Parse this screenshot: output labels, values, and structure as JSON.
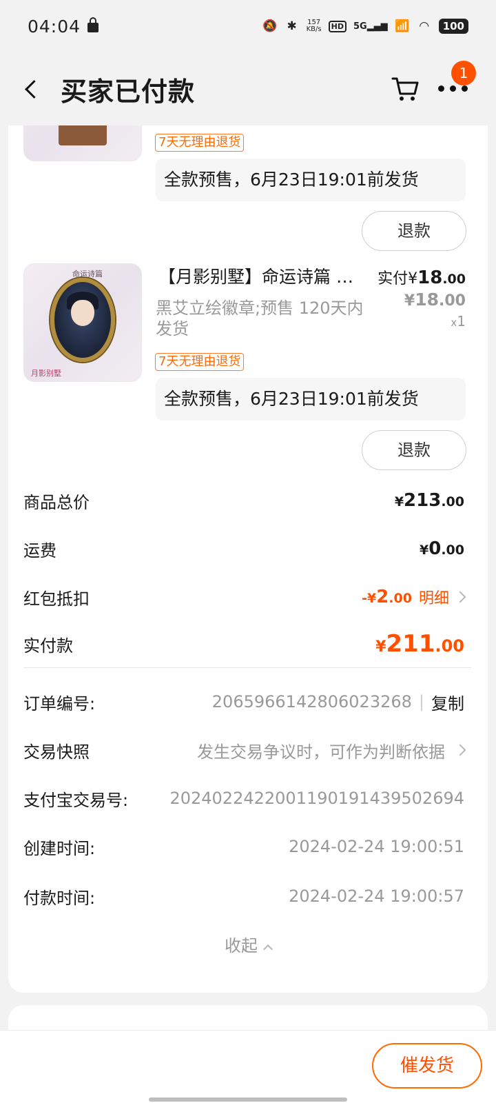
{
  "status_bar": {
    "time": "04:04",
    "net_speed_value": "157",
    "net_speed_unit": "KB/s",
    "hd": "HD",
    "signal": "5G",
    "battery": "100"
  },
  "nav": {
    "title": "买家已付款",
    "badge_count": "1"
  },
  "items": [
    {
      "return_tag": "7天无理由退货",
      "presale_text": "全款预售，6月23日19:01前发货",
      "refund_label": "退款"
    },
    {
      "title": "【月影别墅】命运诗篇 …",
      "sku": "黑艾立绘徽章;预售 120天内发货",
      "paid_label": "实付",
      "paid_currency": "¥",
      "paid_int": "18",
      "paid_dec": ".00",
      "orig_currency": "¥",
      "orig_int": "18",
      "orig_dec": ".00",
      "qty_prefix": "x",
      "qty": "1",
      "return_tag": "7天无理由退货",
      "presale_text": "全款预售，6月23日19:01前发货",
      "refund_label": "退款",
      "thumb_logo": "命运诗篇",
      "thumb_brand": "月影别墅"
    }
  ],
  "summary": {
    "goods_total_label": "商品总价",
    "goods_total_cur": "¥",
    "goods_total_int": "213",
    "goods_total_dec": ".00",
    "shipping_label": "运费",
    "shipping_cur": "¥",
    "shipping_int": "0",
    "shipping_dec": ".00",
    "coupon_label": "红包抵扣",
    "coupon_prefix": "-¥",
    "coupon_int": "2",
    "coupon_dec": ".00",
    "coupon_detail": "明细",
    "paid_label": "实付款",
    "paid_cur": "¥",
    "paid_int": "211",
    "paid_dec": ".00"
  },
  "order_info": {
    "order_no_label": "订单编号:",
    "order_no": "2065966142806023268",
    "sep": "|",
    "copy_label": "复制",
    "snapshot_label": "交易快照",
    "snapshot_hint": "发生交易争议时，可作为判断依据",
    "alipay_label": "支付宝交易号:",
    "alipay_no": "2024022422001190191439502694",
    "created_label": "创建时间:",
    "created_time": "2024-02-24 19:00:51",
    "paid_time_label": "付款时间:",
    "paid_time": "2024-02-24 19:00:57",
    "collapse_label": "收起"
  },
  "bottom": {
    "urge_label": "催发货"
  },
  "colors": {
    "accent": "#ff5000",
    "background": "#f2f2f2"
  }
}
